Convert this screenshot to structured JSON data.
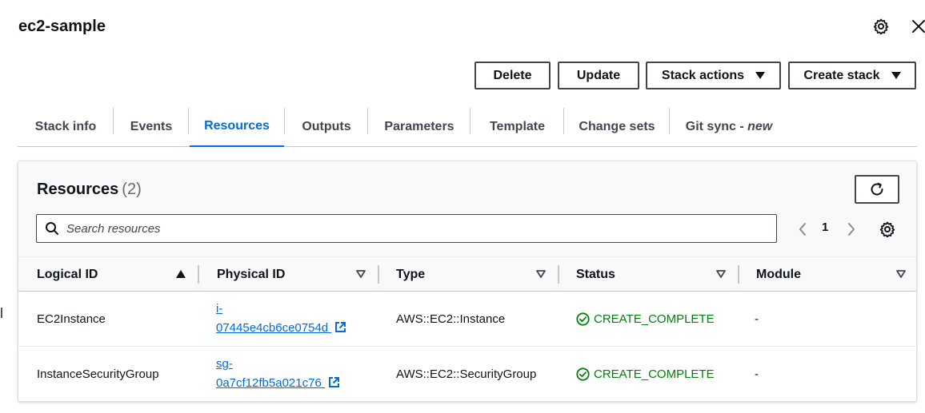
{
  "header": {
    "title": "ec2-sample"
  },
  "icons": {
    "settings": "gear-icon",
    "close": "close-icon"
  },
  "actions": {
    "delete": "Delete",
    "update": "Update",
    "stack_actions": "Stack actions",
    "create_stack": "Create stack"
  },
  "tabs": [
    {
      "label": "Stack info"
    },
    {
      "label": "Events"
    },
    {
      "label": "Resources",
      "active": true
    },
    {
      "label": "Outputs"
    },
    {
      "label": "Parameters"
    },
    {
      "label": "Template"
    },
    {
      "label": "Change sets"
    },
    {
      "label": "Git sync - ",
      "suffix": "new"
    }
  ],
  "resources": {
    "title": "Resources",
    "count": "(2)",
    "search_placeholder": "Search resources",
    "page": "1",
    "columns": [
      "Logical ID",
      "Physical ID",
      "Type",
      "Status",
      "Module"
    ],
    "rows": [
      {
        "logical_id": "EC2Instance",
        "physical_id_line1": "i-",
        "physical_id_line2": "07445e4cb6ce0754d",
        "type": "AWS::EC2::Instance",
        "status": "CREATE_COMPLETE",
        "module": "-"
      },
      {
        "logical_id": "InstanceSecurityGroup",
        "physical_id_line1": "sg-",
        "physical_id_line2": "0a7cf12fb5a021c76",
        "type": "AWS::EC2::SecurityGroup",
        "status": "CREATE_COMPLETE",
        "module": "-"
      }
    ]
  },
  "colors": {
    "accent": "#006ce0",
    "success": "#037f0c",
    "text": "#0f141a"
  }
}
